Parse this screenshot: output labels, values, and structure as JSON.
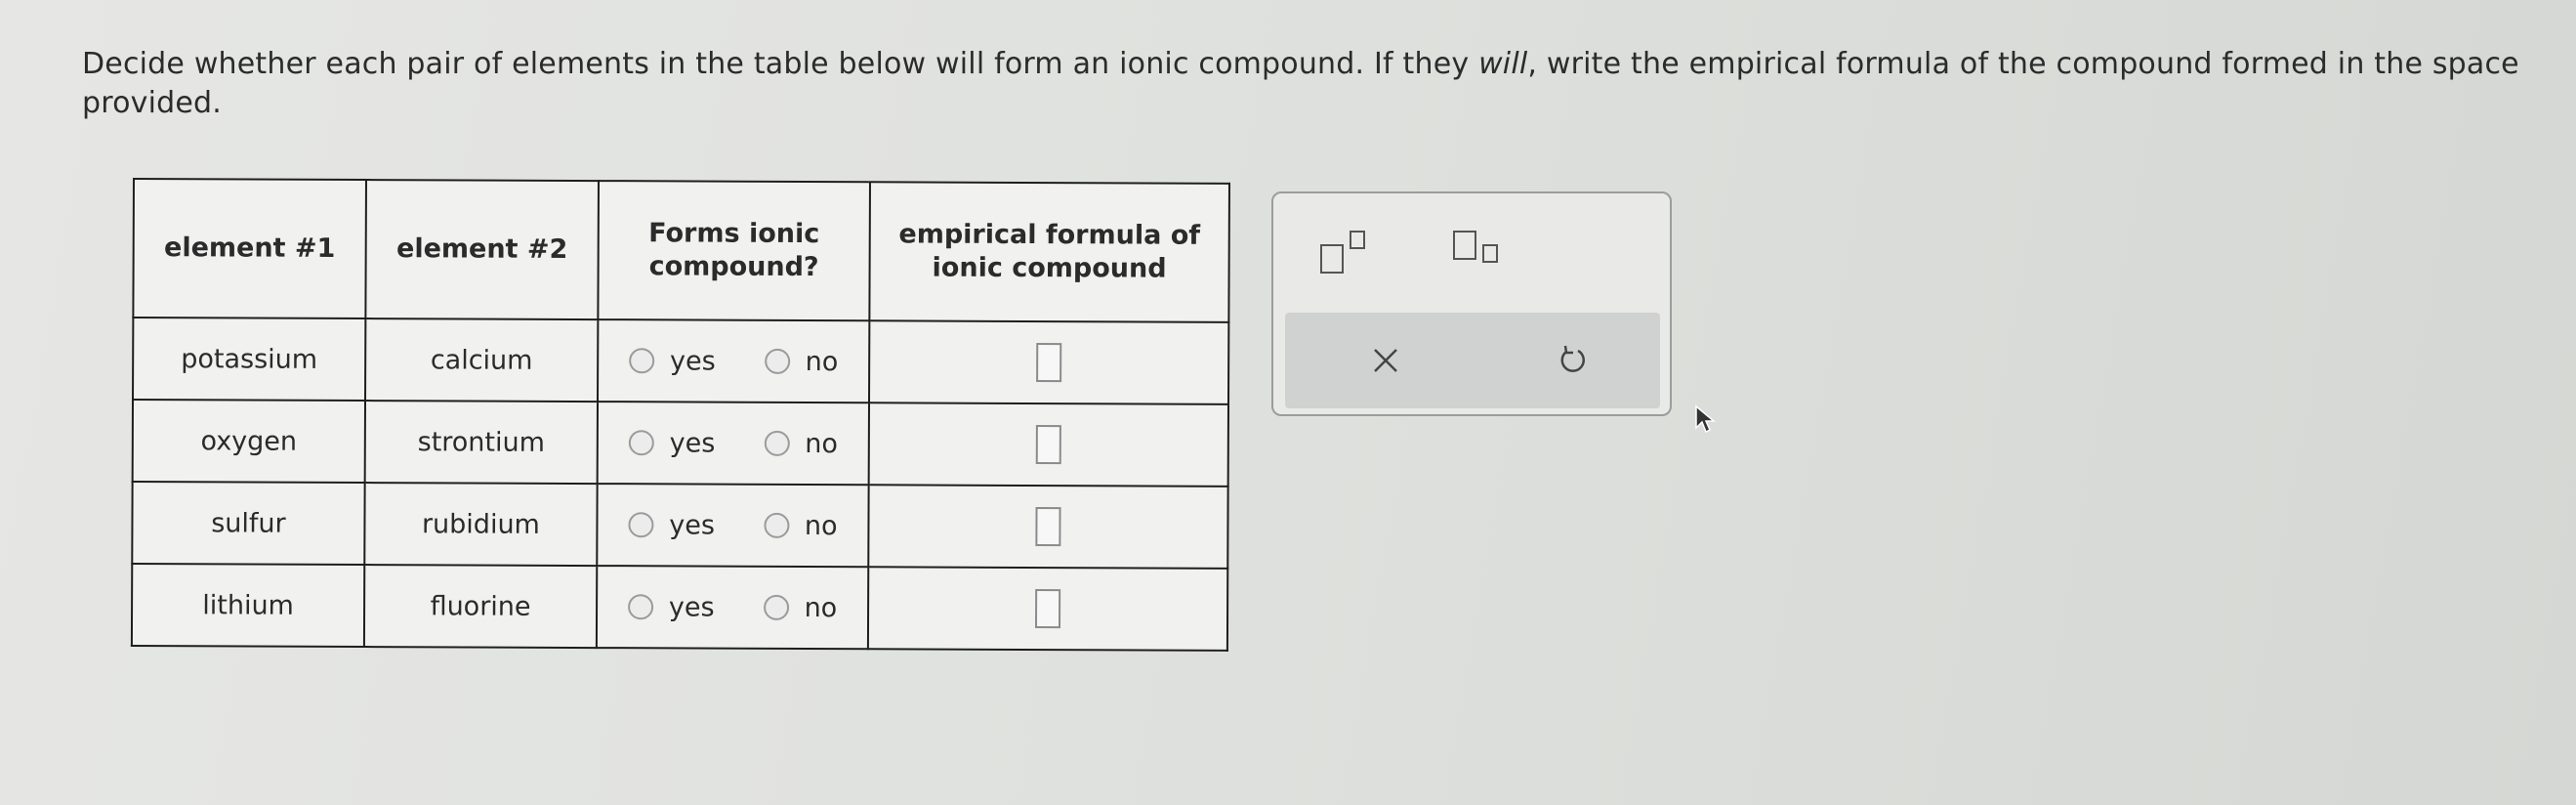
{
  "instructions": {
    "part1": "Decide whether each pair of elements in the table below will form an ionic compound. If they ",
    "emphasis": "will",
    "part2": ", write the empirical formula of the compound formed in the space provided."
  },
  "table": {
    "headers": {
      "element1": "element #1",
      "element2": "element #2",
      "forms_line1": "Forms ionic",
      "forms_line2": "compound?",
      "formula_line1": "empirical formula of",
      "formula_line2": "ionic compound"
    },
    "rows": [
      {
        "element1": "potassium",
        "element2": "calcium",
        "yes": "yes",
        "no": "no"
      },
      {
        "element1": "oxygen",
        "element2": "strontium",
        "yes": "yes",
        "no": "no"
      },
      {
        "element1": "sulfur",
        "element2": "rubidium",
        "yes": "yes",
        "no": "no"
      },
      {
        "element1": "lithium",
        "element2": "fluorine",
        "yes": "yes",
        "no": "no"
      }
    ]
  },
  "tools": {
    "superscript_icon": "superscript-icon",
    "subscript_icon": "subscript-icon",
    "clear_icon": "x-icon",
    "undo_icon": "undo-icon"
  }
}
